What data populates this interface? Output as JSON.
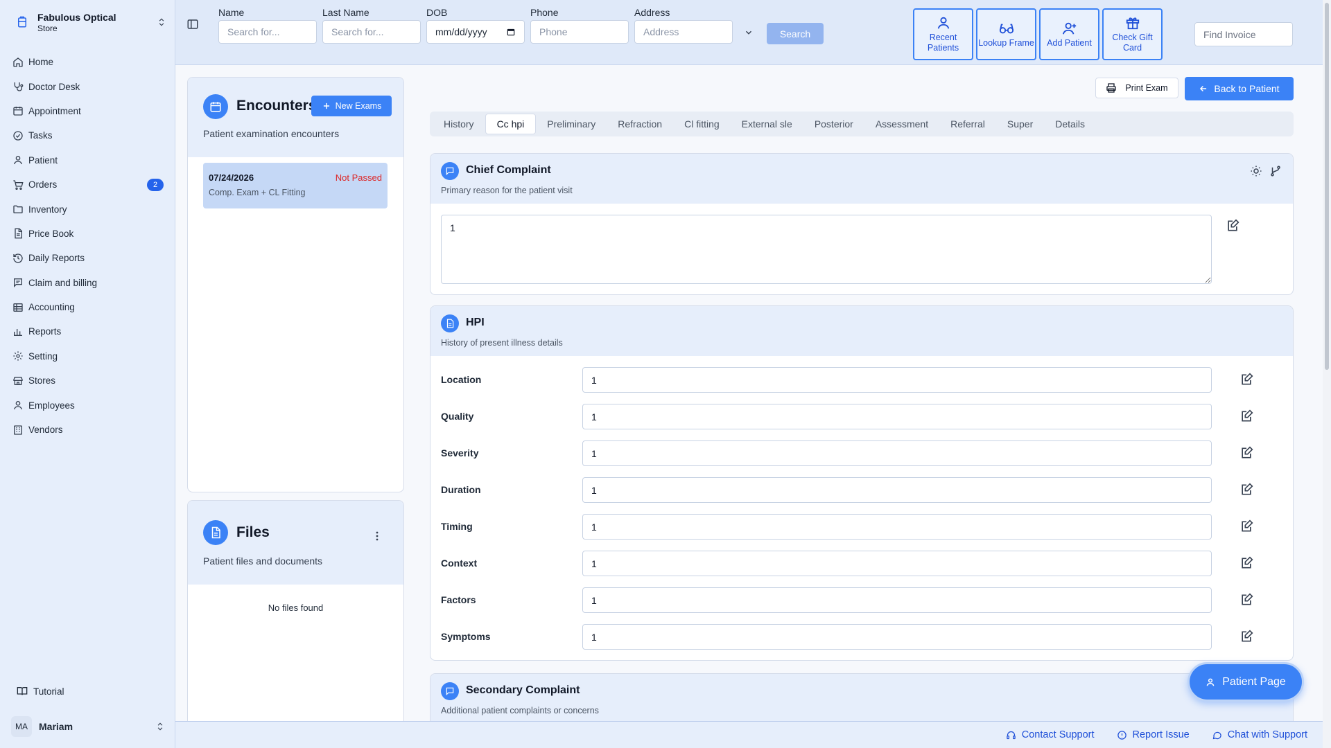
{
  "store": {
    "name": "Fabulous Optical",
    "type": "Store"
  },
  "nav": {
    "home": "Home",
    "doctor_desk": "Doctor Desk",
    "appointment": "Appointment",
    "tasks": "Tasks",
    "patient": "Patient",
    "orders": "Orders",
    "orders_badge": "2",
    "inventory": "Inventory",
    "price_book": "Price Book",
    "daily_reports": "Daily Reports",
    "claim_billing": "Claim and billing",
    "accounting": "Accounting",
    "reports": "Reports",
    "setting": "Setting",
    "stores": "Stores",
    "employees": "Employees",
    "vendors": "Vendors"
  },
  "tutorial": "Tutorial",
  "user": {
    "initials": "MA",
    "name": "Mariam"
  },
  "search": {
    "name_label": "Name",
    "name_placeholder": "Search for...",
    "last_label": "Last Name",
    "last_placeholder": "Search for...",
    "dob_label": "DOB",
    "dob_value": "mm/dd/yyyy",
    "phone_label": "Phone",
    "phone_placeholder": "Phone",
    "address_label": "Address",
    "address_placeholder": "Address",
    "button": "Search"
  },
  "quick": {
    "recent": "Recent Patients",
    "lookup": "Lookup Frame",
    "add": "Add Patient",
    "gift": "Check Gift Card"
  },
  "find_invoice_placeholder": "Find Invoice",
  "encounters": {
    "title": "Encounters",
    "subtitle": "Patient examination encounters",
    "new_button": "New Exams",
    "items": [
      {
        "date": "07/24/2026",
        "status": "Not Passed",
        "type": "Comp. Exam + CL Fitting"
      }
    ]
  },
  "files": {
    "title": "Files",
    "subtitle": "Patient files and documents",
    "empty": "No files found"
  },
  "actions": {
    "print": "Print Exam",
    "back": "Back to Patient"
  },
  "tabs": [
    "History",
    "Cc hpi",
    "Preliminary",
    "Refraction",
    "Cl fitting",
    "External sle",
    "Posterior",
    "Assessment",
    "Referral",
    "Super",
    "Details"
  ],
  "chief": {
    "title": "Chief Complaint",
    "subtitle": "Primary reason for the patient visit",
    "value": "1"
  },
  "hpi": {
    "title": "HPI",
    "subtitle": "History of present illness details",
    "rows": [
      {
        "label": "Location",
        "value": "1"
      },
      {
        "label": "Quality",
        "value": "1"
      },
      {
        "label": "Severity",
        "value": "1"
      },
      {
        "label": "Duration",
        "value": "1"
      },
      {
        "label": "Timing",
        "value": "1"
      },
      {
        "label": "Context",
        "value": "1"
      },
      {
        "label": "Factors",
        "value": "1"
      },
      {
        "label": "Symptoms",
        "value": "1"
      }
    ]
  },
  "secondary": {
    "title": "Secondary Complaint",
    "subtitle": "Additional patient complaints or concerns"
  },
  "patient_page": "Patient Page",
  "footer": {
    "contact": "Contact Support",
    "report": "Report Issue",
    "chat": "Chat with Support"
  },
  "colors": {
    "accent": "#3b82f6",
    "sidebar_bg": "#e6eefb",
    "status_fail": "#dc2626"
  }
}
